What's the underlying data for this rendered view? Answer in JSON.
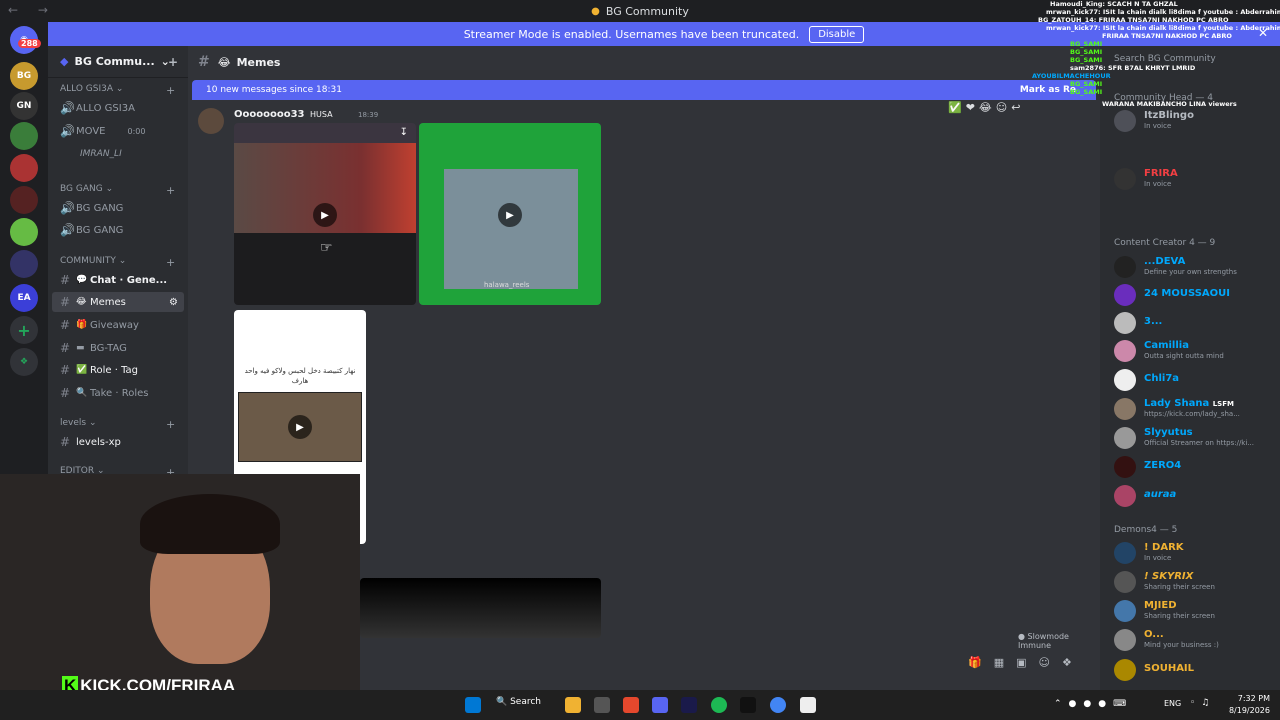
{
  "window": {
    "title": "BG Community"
  },
  "streamer_bar": {
    "text": "Streamer Mode is enabled. Usernames have been truncated.",
    "button": "Disable"
  },
  "guild_badge": "288",
  "server": {
    "name": "BG Commu..."
  },
  "channels": {
    "voice1": {
      "category": "ALLO GSI3A",
      "items": [
        "ALLO GSI3A",
        "MOVE",
        "IMRAN_LI"
      ],
      "move_time": "0:00"
    },
    "voice2": {
      "category": "BG GANG",
      "items": [
        "BG GANG",
        "BG GANG"
      ]
    },
    "community": {
      "category": "COMMUNITY",
      "items": [
        "Chat · Gene...",
        "Memes",
        "Giveaway",
        "BG-TAG",
        "Role · Tag",
        "Take · Roles"
      ]
    },
    "levels": {
      "category": "levels",
      "items": [
        "levels-xp"
      ]
    },
    "editor": {
      "category": "EDITOR"
    }
  },
  "chat": {
    "channel": "Memes",
    "new_messages": "10 new messages since 18:31",
    "mark_read": "Mark as Re",
    "author": "Oooooooo33",
    "tag": "HUSA",
    "time": "18:39",
    "watermark": "halawa_reels",
    "meme_text": "نهار كتبيصة دخل لحبس ولاكو فيه واحد هارف",
    "slowmode": "Slowmode Immune"
  },
  "members": {
    "search": "Search BG Community",
    "groups": [
      {
        "label": "Community Head — 4"
      },
      {
        "label": "Content Creator 4 — 9"
      },
      {
        "label": "Demons4 — 5"
      }
    ],
    "list": [
      {
        "name": "ItzBlingo",
        "status": "In voice",
        "color": "#b5bac1"
      },
      {
        "name": "FRIRA",
        "status": "In voice",
        "color": "#f23f43"
      },
      {
        "name": "...DEVA",
        "status": "Define your own strengths",
        "color": "#00a8fc"
      },
      {
        "name": "24 MOUSSAOUI",
        "status": "",
        "color": "#00a8fc"
      },
      {
        "name": "3...",
        "status": "",
        "color": "#00a8fc"
      },
      {
        "name": "Camillia",
        "status": "Outta sight outta mind",
        "color": "#00a8fc"
      },
      {
        "name": "Chli7a",
        "status": "",
        "color": "#00a8fc"
      },
      {
        "name": "Lady Shana",
        "status": "https://kick.com/lady_sha...",
        "color": "#00a8fc"
      },
      {
        "name": "Slyyutus",
        "status": "Official Streamer on https://ki...",
        "color": "#00a8fc"
      },
      {
        "name": "ZERO4",
        "status": "",
        "color": "#00a8fc"
      },
      {
        "name": "auraa",
        "status": "",
        "color": "#00a8fc"
      },
      {
        "name": "! DARK",
        "status": "In voice",
        "color": "#f0b232"
      },
      {
        "name": "! SKYRIX",
        "status": "Sharing their screen",
        "color": "#f0b232"
      },
      {
        "name": "MJIED",
        "status": "Sharing their screen",
        "color": "#f0b232"
      },
      {
        "name": "O...",
        "status": "Mind your business :)",
        "color": "#f0b232"
      },
      {
        "name": "SOUHAIL",
        "status": "",
        "color": "#f0b232"
      }
    ],
    "lady_tag": "LSFM"
  },
  "stream_chat": [
    "Hamoudi_King: SCACH N TA GHZAL",
    "mrwan_kick77: ISIt la chain dialk li8dima f youtube : Abderrahim frira 2",
    "BG_ZATOUH_14: FRIRAA TNSA7NI NAKHOD PC ABRO",
    "mrwan_kick77: ISIt la chain dialk li8dima f youtube : Abderrahim frira 2",
    "FRIRAA TNSA7NI NAKHOD PC ABRO",
    "BG_SAMI",
    "BG_SAMI",
    "BG_SAMI",
    "sam2876: SFR B7AL KHRYT LMRID",
    "AYOUBILMACHEHOUR",
    "BG_SAMI",
    "BG_SAMI",
    "WARANA MAKIBANCHO LINA viewers"
  ],
  "overlay": {
    "kick_url": "KICK.COM/FRIRAA"
  },
  "taskbar": {
    "search": "Search",
    "lang": "ENG",
    "time": "7:32 PM",
    "date": "8/19/2026"
  }
}
